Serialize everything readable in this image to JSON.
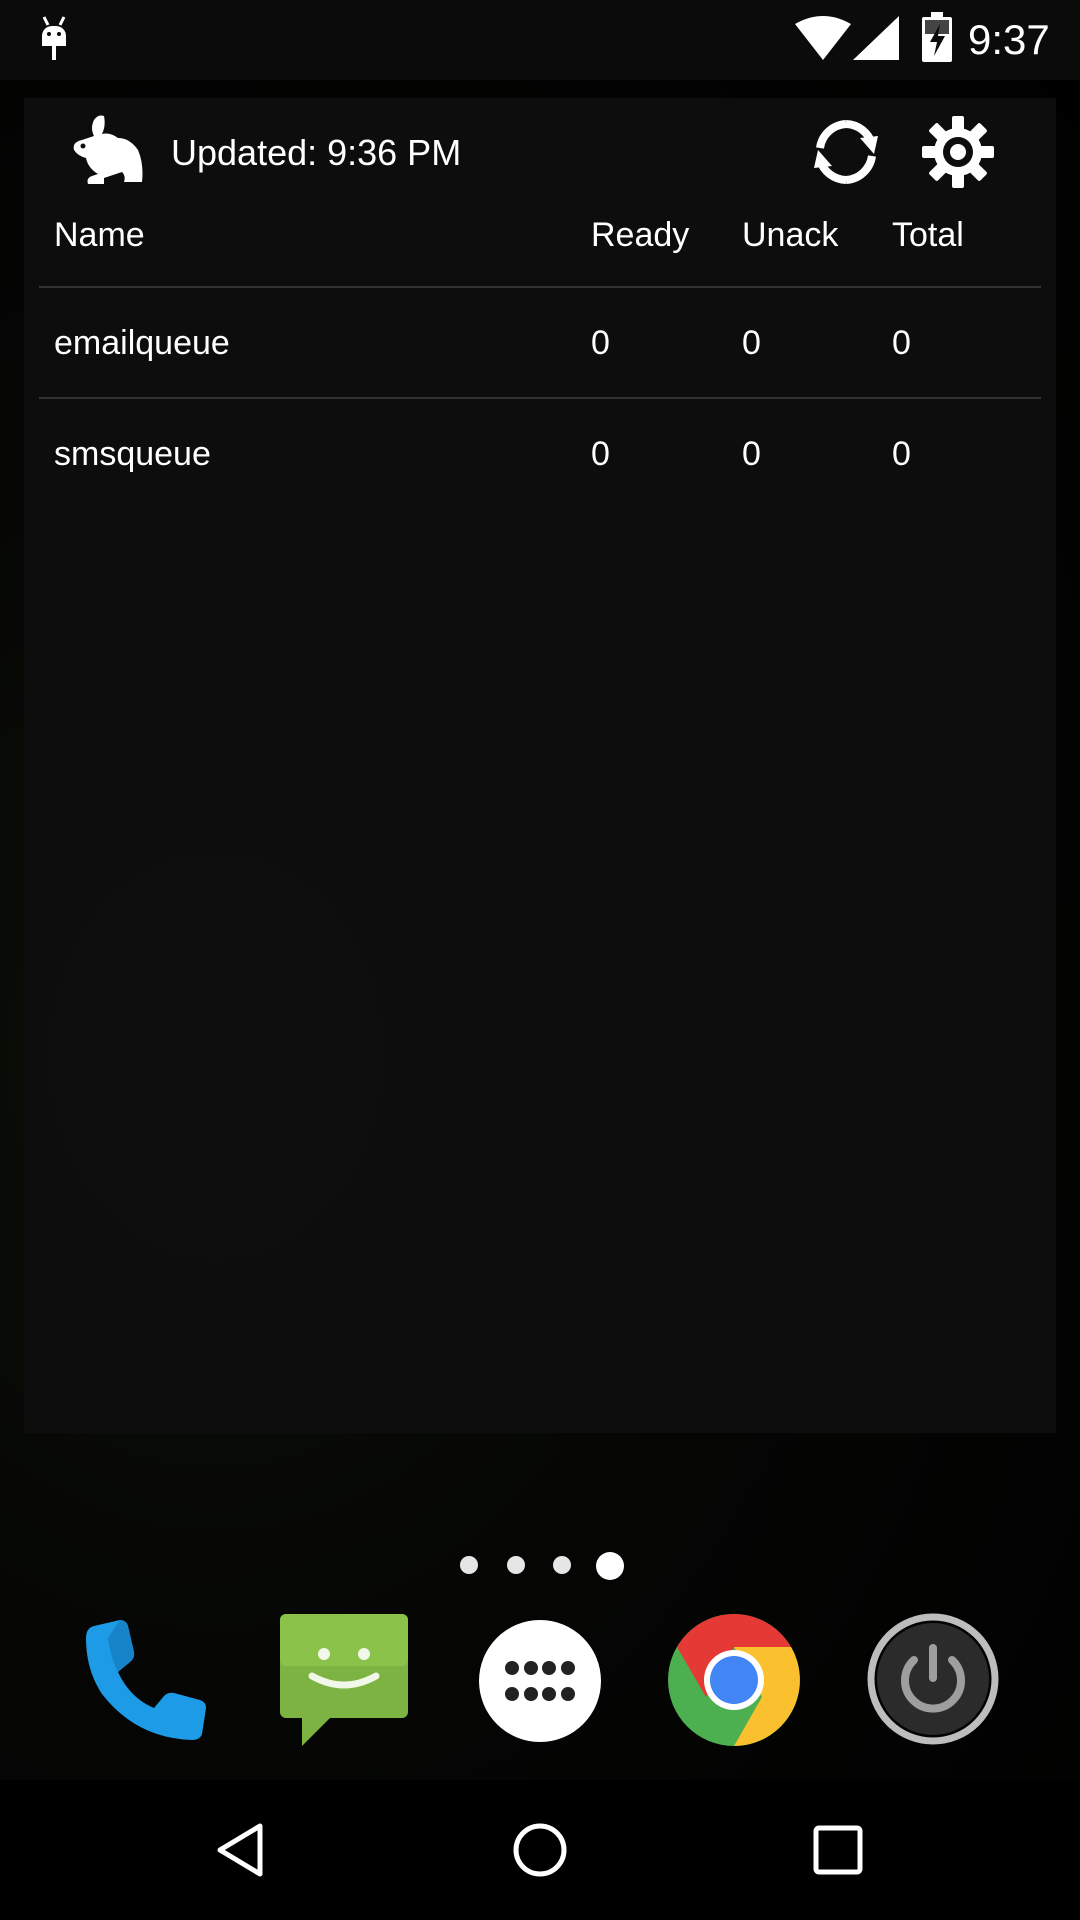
{
  "status_bar": {
    "time": "9:37",
    "icons": [
      "android-debug-icon",
      "wifi-icon",
      "cell-signal-icon",
      "battery-charging-icon"
    ]
  },
  "widget": {
    "logo_icon": "rabbit-icon",
    "updated_text": "Updated: 9:36 PM",
    "refresh_icon": "refresh-icon",
    "settings_icon": "gear-icon",
    "columns": [
      "Name",
      "Ready",
      "Unack",
      "Total"
    ],
    "rows": [
      {
        "name": "emailqueue",
        "ready": "0",
        "unack": "0",
        "total": "0"
      },
      {
        "name": "smsqueue",
        "ready": "0",
        "unack": "0",
        "total": "0"
      }
    ]
  },
  "home_screen": {
    "page_indicator": {
      "pages": 4,
      "current": 4
    },
    "dock": [
      "phone-icon",
      "messaging-icon",
      "app-drawer-icon",
      "chrome-icon",
      "power-icon"
    ]
  },
  "nav_bar": [
    "back-icon",
    "home-icon",
    "recent-apps-icon"
  ],
  "colors": {
    "widget_background": "#0e0e0e",
    "divider": "#333333",
    "phone_blue": "#1e9be6",
    "messaging_green": "#7cb342"
  }
}
